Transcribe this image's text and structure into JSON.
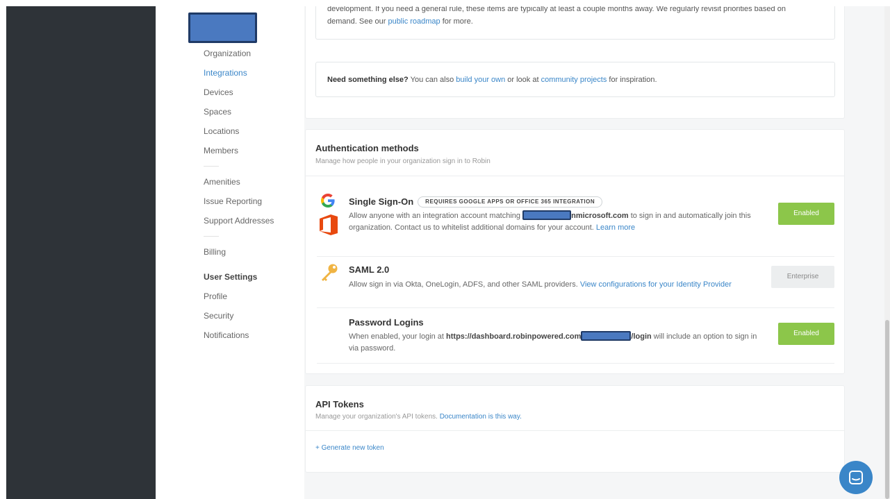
{
  "sidebar": {
    "items": [
      {
        "label": "Organization"
      },
      {
        "label": "Integrations"
      },
      {
        "label": "Devices"
      },
      {
        "label": "Spaces"
      },
      {
        "label": "Locations"
      },
      {
        "label": "Members"
      },
      {
        "label": "Amenities"
      },
      {
        "label": "Issue Reporting"
      },
      {
        "label": "Support Addresses"
      },
      {
        "label": "Billing"
      }
    ],
    "user_settings_heading": "User Settings",
    "user_items": [
      {
        "label": "Profile"
      },
      {
        "label": "Security"
      },
      {
        "label": "Notifications"
      }
    ]
  },
  "roadmap": {
    "text_line1": "development. If you need a general rule, these items are typically at least a couple months away. We regularly revisit priorities based on",
    "text_line2_prefix": "demand. See our",
    "roadmap_link": "public roadmap",
    "text_line2_suffix": "for more."
  },
  "need_else": {
    "strong": "Need something else?",
    "text1": "You can also",
    "link1": "build your own",
    "text2": "or look at",
    "link2": "community projects",
    "text3": "for inspiration."
  },
  "auth": {
    "title": "Authentication methods",
    "subtitle": "Manage how people in your organization sign in to Robin",
    "sso": {
      "title": "Single Sign-On",
      "badge": "REQUIRES GOOGLE APPS OR OFFICE 365 INTEGRATION",
      "desc_prefix": "Allow anyone with an integration account matching",
      "domain_suffix": "nmicrosoft.com",
      "desc_suffix": "to sign in and automatically join this",
      "desc_line2": "organization. Contact us to whitelist additional domains for your account.",
      "learn_more": "Learn more",
      "button": "Enabled"
    },
    "saml": {
      "title": "SAML 2.0",
      "desc": "Allow sign in via Okta, OneLogin, ADFS, and other SAML providers.",
      "link": "View configurations for your Identity Provider",
      "button": "Enterprise"
    },
    "password": {
      "title": "Password Logins",
      "desc_prefix": "When enabled, your login at",
      "url_prefix": "https://dashboard.robinpowered.com",
      "url_suffix": "/login",
      "desc_suffix": "will include an option to sign in",
      "desc_line2": "via password.",
      "button": "Enabled"
    }
  },
  "api": {
    "title": "API Tokens",
    "subtitle": "Manage your organization's API tokens.",
    "doc_link": "Documentation is this way.",
    "generate": "+ Generate new token"
  },
  "colors": {
    "dark_panel": "#2e3338",
    "link_blue": "#3a86c8",
    "enabled_green": "#8cc64a",
    "redaction_blue": "#4a79c0"
  }
}
